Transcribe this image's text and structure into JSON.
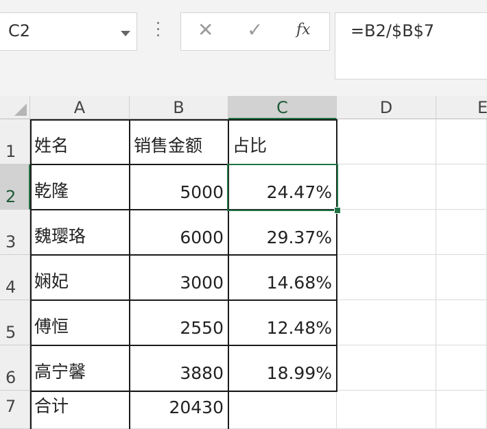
{
  "name_box": {
    "value": "C2"
  },
  "formula_bar": {
    "cancel_icon": "✕",
    "enter_icon": "✓",
    "fx_label": "fx",
    "formula": "=B2/$B$7"
  },
  "columns": [
    "A",
    "B",
    "C",
    "D",
    "E"
  ],
  "rows": [
    "1",
    "2",
    "3",
    "4",
    "5",
    "6",
    "7"
  ],
  "selected_cell": "C2",
  "accent_color": "#217346",
  "sheet": {
    "header": {
      "name": "姓名",
      "sales": "销售金额",
      "ratio": "占比"
    },
    "data": [
      {
        "name": "乾隆",
        "sales": "5000",
        "ratio": "24.47%"
      },
      {
        "name": "魏璎珞",
        "sales": "6000",
        "ratio": "29.37%"
      },
      {
        "name": "娴妃",
        "sales": "3000",
        "ratio": "14.68%"
      },
      {
        "name": "傅恒",
        "sales": "2550",
        "ratio": "12.48%"
      },
      {
        "name": "高宁馨",
        "sales": "3880",
        "ratio": "18.99%"
      }
    ],
    "total": {
      "name": "合计",
      "sales": "20430"
    }
  }
}
